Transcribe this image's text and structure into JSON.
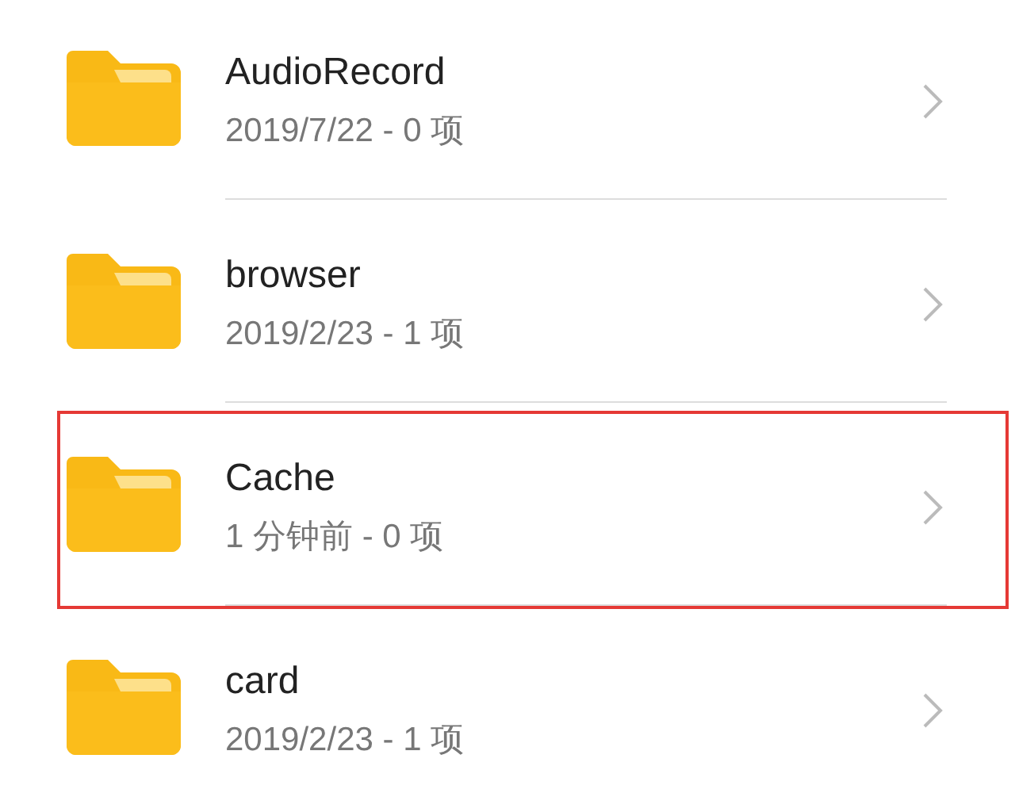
{
  "folders": [
    {
      "name": "AudioRecord",
      "details": "2019/7/22 - 0 项",
      "highlighted": false
    },
    {
      "name": "browser",
      "details": "2019/2/23 - 1 项",
      "highlighted": false
    },
    {
      "name": "Cache",
      "details": "1 分钟前 - 0 项",
      "highlighted": true
    },
    {
      "name": "card",
      "details": "2019/2/23 - 1 项",
      "highlighted": false
    }
  ]
}
